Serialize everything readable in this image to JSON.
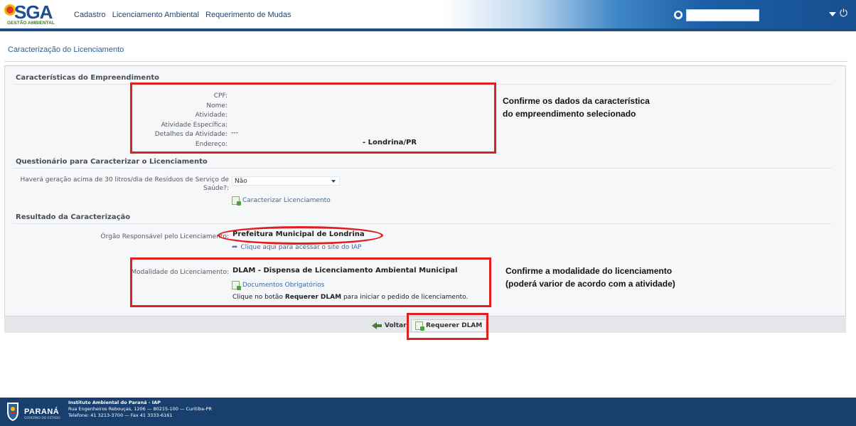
{
  "header": {
    "logo_text": "SGA",
    "logo_subtitle": "GESTÃO AMBIENTAL",
    "nav": [
      "Cadastro",
      "Licenciamento Ambiental",
      "Requerimento de Mudas"
    ],
    "search_value": ""
  },
  "breadcrumb": "Caracterização do Licenciamento",
  "section1": {
    "title": "Características do Empreendimento",
    "fields": [
      {
        "label": "CPF:",
        "value": ""
      },
      {
        "label": "Nome:",
        "value": ""
      },
      {
        "label": "Atividade:",
        "value": ""
      },
      {
        "label": "Atividade Específica:",
        "value": ""
      },
      {
        "label": "Detalhes da Atividade:",
        "value": "---"
      },
      {
        "label": "Endereço:",
        "value": "- Londrina/PR"
      }
    ],
    "note": [
      "Confirme os dados da característica",
      "do empreendimento selecionado"
    ]
  },
  "section2": {
    "title": "Questionário para Caracterizar o Licenciamento",
    "question_line1": "Haverá geração acima de 30 litros/dia de Resíduos de Serviço de",
    "question_line2": "Saúde?:",
    "select_value": "Não",
    "action_link": "Caracterizar Licenciamento"
  },
  "section3": {
    "title": "Resultado da Caracterização",
    "orgao_label": "Órgão Responsável pelo Licenciamento:",
    "orgao_value": "Prefeitura Municipal de Londrina",
    "site_link": "Clique aqui para acessar o site do IAP",
    "modalidade_label": "Modalidade do Licenciamento:",
    "modalidade_value": "DLAM - Dispensa de Licenciamento Ambiental Municipal",
    "docs_link": "Documentos Obrigatórios",
    "instr_before": "Clique no botão",
    "instr_bold": "Requerer DLAM",
    "instr_after": "para iniciar o pedido de licenciamento.",
    "note": [
      "Confirme a modalidade  do licenciamento",
      "(poderá varior de acordo com a atividade)"
    ]
  },
  "buttons": {
    "back": "Voltar",
    "submit": "Requerer DLAM"
  },
  "footer": {
    "state": "PARANÁ",
    "state_sub": "GOVERNO DO ESTADO",
    "institute": "Instituto Ambiental do Paraná - IAP",
    "address": "Rua Engenheiros Rebouças, 1206 — 80215-100 — Curitiba-PR",
    "phone": "Telefone: 41 3213-3700 — Fax 41 3333-6161"
  },
  "colors": {
    "header_blue": "#1c5fa6",
    "footer_blue": "#183f6e",
    "annotation_red": "#e02020",
    "link_blue": "#3a6aa0"
  }
}
